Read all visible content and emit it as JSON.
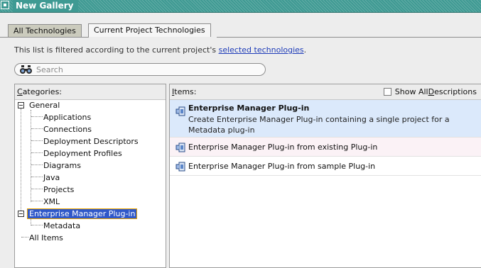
{
  "window": {
    "title": "New Gallery"
  },
  "tabs": [
    {
      "label": "All Technologies",
      "active": false
    },
    {
      "label": "Current Project Technologies",
      "active": true
    }
  ],
  "filter_notice": {
    "text": "This list is filtered according to the current project's ",
    "link": "selected technologies",
    "suffix": "."
  },
  "search": {
    "placeholder": "Search",
    "value": ""
  },
  "categories": {
    "header_mnemonic": "C",
    "header_rest": "ategories:",
    "tree": [
      {
        "label": "General",
        "expanded": true,
        "children": [
          "Applications",
          "Connections",
          "Deployment Descriptors",
          "Deployment Profiles",
          "Diagrams",
          "Java",
          "Projects",
          "XML"
        ]
      },
      {
        "label": "Enterprise Manager Plug-in",
        "expanded": true,
        "selected": true,
        "children": [
          "Metadata"
        ]
      },
      {
        "label": "All Items"
      }
    ]
  },
  "items": {
    "header_mnemonic": "I",
    "header_rest": "tems:",
    "show_all_prefix": "Show All ",
    "show_all_mnemonic": "D",
    "show_all_rest": "escriptions",
    "show_all_checked": false,
    "list": [
      {
        "title": "Enterprise Manager Plug-in",
        "description": "Create Enterprise Manager Plug-in containing a single project for a Metadata plug-in",
        "selected": true
      },
      {
        "title": "Enterprise Manager Plug-in from existing Plug-in"
      },
      {
        "title": "Enterprise Manager Plug-in from sample Plug-in"
      }
    ]
  },
  "colors": {
    "titlebar": "#3f9a93",
    "selection": "#2f58c9",
    "item_selected": "#dbe9fb",
    "link": "#1e3cb8"
  }
}
